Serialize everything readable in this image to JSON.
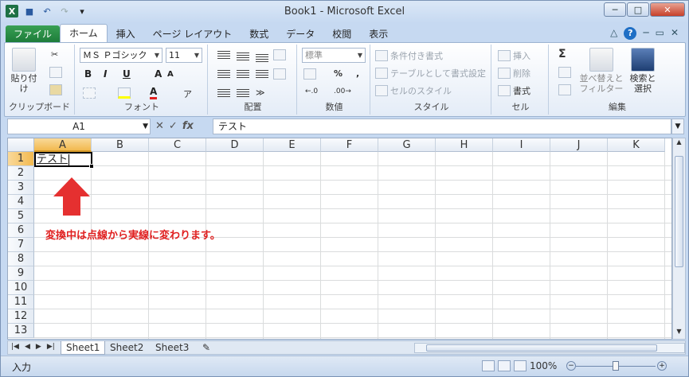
{
  "window": {
    "title": "Book1 - Microsoft Excel",
    "controls": {
      "minimize": "─",
      "maximize": "□",
      "close": "✕"
    }
  },
  "quick_access": {
    "save": "■",
    "undo": "↶",
    "redo": "↷",
    "customize": "▾"
  },
  "tabs": [
    {
      "label": "ファイル"
    },
    {
      "label": "ホーム"
    },
    {
      "label": "挿入"
    },
    {
      "label": "ページ レイアウト"
    },
    {
      "label": "数式"
    },
    {
      "label": "データ"
    },
    {
      "label": "校閲"
    },
    {
      "label": "表示"
    }
  ],
  "ribbon": {
    "clipboard": {
      "paste": "貼り付け",
      "label": "クリップボード"
    },
    "font": {
      "name": "ＭＳ Ｐゴシック",
      "size": "11",
      "bold": "B",
      "italic": "I",
      "underline": "U",
      "grow": "A",
      "shrink": "A",
      "color_letter": "A",
      "label": "フォント"
    },
    "alignment": {
      "label": "配置"
    },
    "number": {
      "format": "標準",
      "percent": "%",
      "comma": ",",
      "label": "数値"
    },
    "styles": {
      "conditional": "条件付き書式",
      "table": "テーブルとして書式設定",
      "cell_styles": "セルのスタイル",
      "label": "スタイル"
    },
    "cells": {
      "insert": "挿入",
      "delete": "削除",
      "format": "書式",
      "label": "セル"
    },
    "editing": {
      "sort": "並べ替えと\nフィルター",
      "sort_l1": "並べ替えと",
      "sort_l2": "フィルター",
      "find_l1": "検索と",
      "find_l2": "選択",
      "sigma": "Σ",
      "label": "編集"
    }
  },
  "formula_bar": {
    "name_box": "A1",
    "fx": "fx",
    "cancel": "✕",
    "enter": "✓",
    "content": "テスト"
  },
  "grid": {
    "columns": [
      "A",
      "B",
      "C",
      "D",
      "E",
      "F",
      "G",
      "H",
      "I",
      "J",
      "K"
    ],
    "rows": [
      "1",
      "2",
      "3",
      "4",
      "5",
      "6",
      "7",
      "8",
      "9",
      "10",
      "11",
      "12",
      "13"
    ],
    "active_cell_text": "テスト"
  },
  "annotation": {
    "text": "変換中は点線から実線に変わります。",
    "color": "#e02020"
  },
  "sheets": [
    "Sheet1",
    "Sheet2",
    "Sheet3"
  ],
  "status": {
    "mode": "入力",
    "zoom": "100%"
  },
  "colors": {
    "file_tab": "#1c7b39",
    "accent": "#f2b94f"
  }
}
